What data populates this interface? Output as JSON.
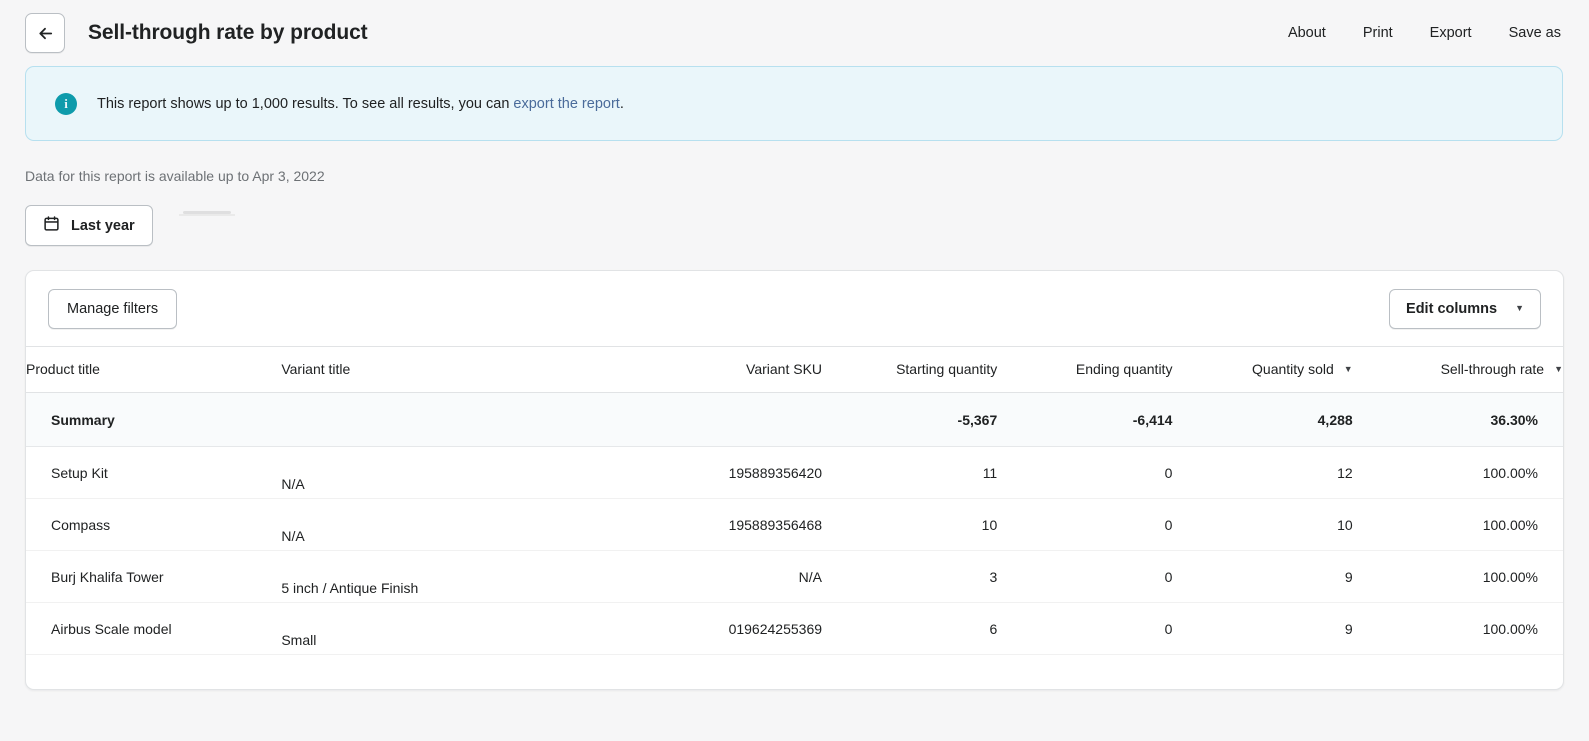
{
  "header": {
    "back_icon": "arrow-left-icon",
    "title": "Sell-through rate by product",
    "actions": [
      {
        "label": "About"
      },
      {
        "label": "Print"
      },
      {
        "label": "Export"
      },
      {
        "label": "Save as"
      }
    ]
  },
  "banner": {
    "icon": "info-icon",
    "text_before": "This report shows up to 1,000 results. To see all results, you can ",
    "link_text": "export the report",
    "text_after": ".",
    "accent_color": "#0e9bab",
    "link_color": "#4a6b9a",
    "background_color": "#eaf6fa"
  },
  "availability": {
    "text": "Data for this report is available up to Apr 3, 2022"
  },
  "date_filter": {
    "icon": "calendar-icon",
    "label": "Last year"
  },
  "toolbar": {
    "manage_filters_label": "Manage filters",
    "edit_columns_label": "Edit columns",
    "edit_columns_caret": "▼"
  },
  "table": {
    "columns": [
      {
        "key": "product",
        "label": "Product title",
        "sortable": false
      },
      {
        "key": "variant",
        "label": "Variant title",
        "sortable": false
      },
      {
        "key": "sku",
        "label": "Variant SKU",
        "sortable": false
      },
      {
        "key": "start",
        "label": "Starting quantity",
        "sortable": false
      },
      {
        "key": "end",
        "label": "Ending quantity",
        "sortable": false
      },
      {
        "key": "sold",
        "label": "Quantity sold",
        "sortable": true,
        "caret": "▼"
      },
      {
        "key": "rate",
        "label": "Sell-through rate",
        "sortable": true,
        "caret": "▼"
      }
    ],
    "summary": {
      "label": "Summary",
      "variant": "",
      "sku": "",
      "start": "-5,367",
      "end": "-6,414",
      "sold": "4,288",
      "rate": "36.30%"
    },
    "rows": [
      {
        "product": "Setup Kit",
        "variant": "N/A",
        "sku": "195889356420",
        "start": "11",
        "end": "0",
        "sold": "12",
        "rate": "100.00%"
      },
      {
        "product": "Compass",
        "variant": "N/A",
        "sku": "195889356468",
        "start": "10",
        "end": "0",
        "sold": "10",
        "rate": "100.00%"
      },
      {
        "product": "Burj Khalifa Tower",
        "variant": "5 inch / Antique Finish",
        "sku": "N/A",
        "start": "3",
        "end": "0",
        "sold": "9",
        "rate": "100.00%"
      },
      {
        "product": "Airbus Scale model",
        "variant": "Small",
        "sku": "019624255369",
        "start": "6",
        "end": "0",
        "sold": "9",
        "rate": "100.00%"
      }
    ]
  }
}
